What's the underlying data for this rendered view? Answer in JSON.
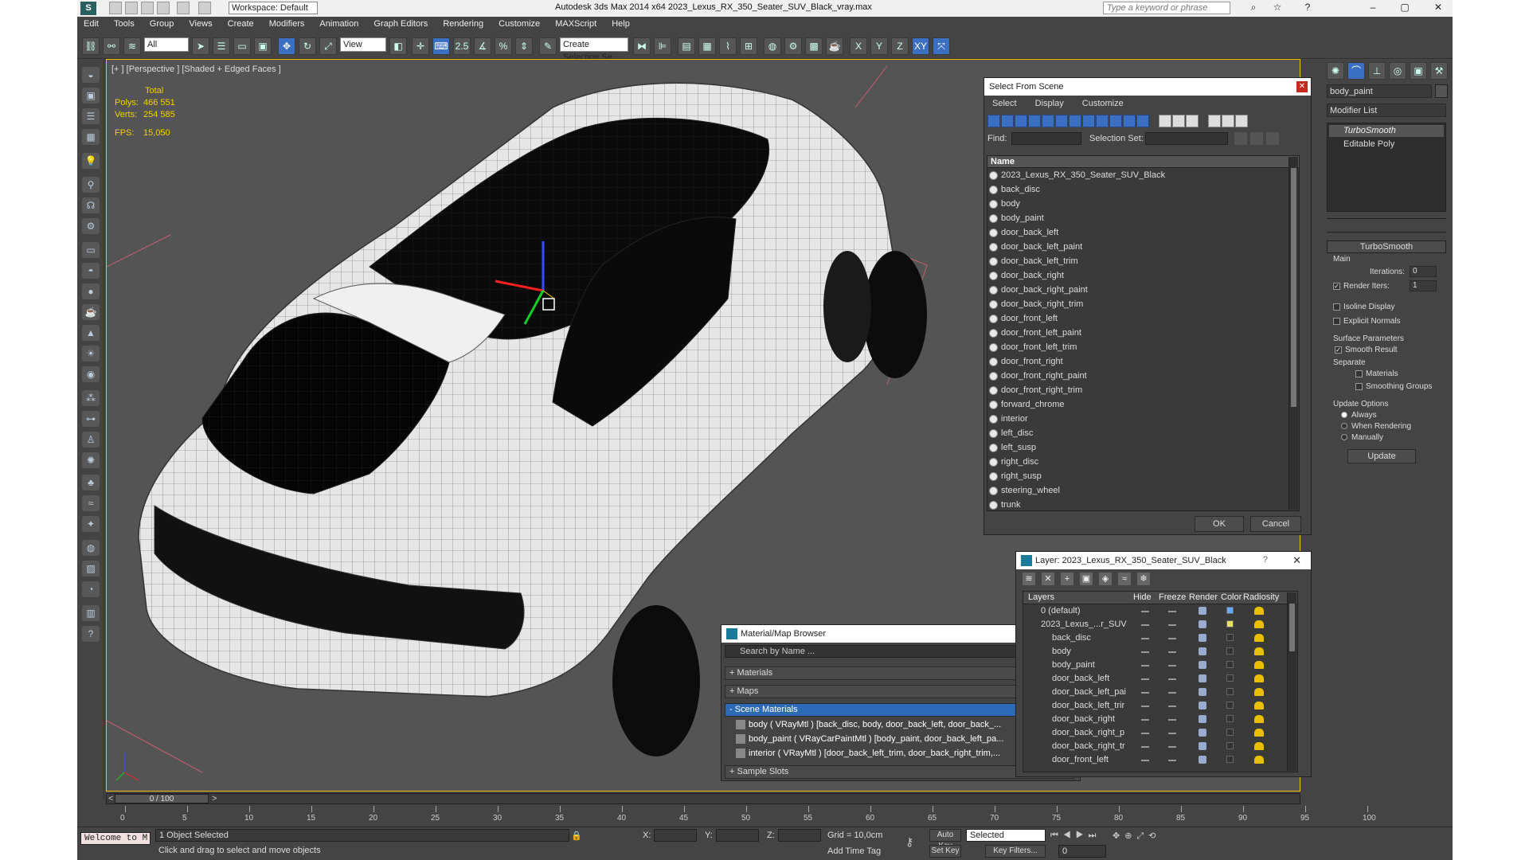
{
  "app": {
    "workspace": "Workspace: Default",
    "title": "Autodesk 3ds Max  2014 x64    2023_Lexus_RX_350_Seater_SUV_Black_vray.max",
    "search_placeholder": "Type a keyword or phrase"
  },
  "menu": [
    "Edit",
    "Tools",
    "Group",
    "Views",
    "Create",
    "Modifiers",
    "Animation",
    "Graph Editors",
    "Rendering",
    "Customize",
    "MAXScript",
    "Help"
  ],
  "toolbar": {
    "filter": "All",
    "refcoord": "View",
    "selset": "Create Selection Se",
    "x": "X",
    "y": "Y",
    "z": "Z",
    "xy": "XY",
    "num25": "2.5",
    "pct": "%"
  },
  "viewport": {
    "label": "[+ ] [Perspective ] [Shaded + Edged Faces ]",
    "stats": {
      "total": "Total",
      "polys_label": "Polys:",
      "polys": "466 551",
      "verts_label": "Verts:",
      "verts": "254 585",
      "fps_label": "FPS:",
      "fps": "15,050"
    }
  },
  "select_from_scene": {
    "title": "Select From Scene",
    "menu": [
      "Select",
      "Display",
      "Customize"
    ],
    "find_label": "Find:",
    "selset_label": "Selection Set:",
    "col_name": "Name",
    "items": [
      "2023_Lexus_RX_350_Seater_SUV_Black",
      "back_disc",
      "body",
      "body_paint",
      "door_back_left",
      "door_back_left_paint",
      "door_back_left_trim",
      "door_back_right",
      "door_back_right_paint",
      "door_back_right_trim",
      "door_front_left",
      "door_front_left_paint",
      "door_front_left_trim",
      "door_front_right",
      "door_front_right_paint",
      "door_front_right_trim",
      "forward_chrome",
      "interior",
      "left_disc",
      "left_susp",
      "right_disc",
      "right_susp",
      "steering_wheel",
      "trunk"
    ],
    "ok": "OK",
    "cancel": "Cancel"
  },
  "material_browser": {
    "title": "Material/Map Browser",
    "search": "Search by Name ...",
    "rollouts": {
      "materials": "+ Materials",
      "maps": "+ Maps",
      "scene": "- Scene Materials",
      "samples": "+ Sample Slots"
    },
    "scene_materials": [
      "body ( VRayMtl ) [back_disc, body, door_back_left, door_back_...",
      "body_paint ( VRayCarPaintMtl ) [body_paint, door_back_left_pa...",
      "interior ( VRayMtl ) [door_back_left_trim, door_back_right_trim,..."
    ]
  },
  "layer_dialog": {
    "title": "Layer: 2023_Lexus_RX_350_Seater_SUV_Black",
    "help": "?",
    "cols": {
      "layers": "Layers",
      "hide": "Hide",
      "freeze": "Freeze",
      "render": "Render",
      "color": "Color",
      "radiosity": "Radiosity"
    },
    "rows": [
      "0 (default)",
      "2023_Lexus_...r_SUV",
      "back_disc",
      "body",
      "body_paint",
      "door_back_left",
      "door_back_left_pai",
      "door_back_left_trir",
      "door_back_right",
      "door_back_right_p",
      "door_back_right_tr",
      "door_front_left"
    ]
  },
  "command_panel": {
    "object_name": "body_paint",
    "modifier_list": "Modifier List",
    "stack": [
      "TurboSmooth",
      "Editable Poly"
    ],
    "rollout_title": "TurboSmooth",
    "main": "Main",
    "iterations_label": "Iterations:",
    "iterations": "0",
    "render_iters_label": "Render Iters:",
    "render_iters": "1",
    "isoline": "Isoline Display",
    "explicit": "Explicit Normals",
    "surface": "Surface Parameters",
    "smooth_result": "Smooth Result",
    "separate": "Separate",
    "materials": "Materials",
    "smoothing_groups": "Smoothing Groups",
    "update_options": "Update Options",
    "always": "Always",
    "when_rendering": "When Rendering",
    "manually": "Manually",
    "update": "Update"
  },
  "timeline": {
    "frame": "0 / 100",
    "ticks": [
      "0",
      "5",
      "10",
      "15",
      "20",
      "25",
      "30",
      "35",
      "40",
      "45",
      "50",
      "55",
      "60",
      "65",
      "70",
      "75",
      "80",
      "85",
      "90",
      "95",
      "100"
    ]
  },
  "status": {
    "welcome": "Welcome to M",
    "selected": "1 Object Selected",
    "prompt": "Click and drag to select and move objects",
    "x_label": "X:",
    "y_label": "Y:",
    "z_label": "Z:",
    "grid": "Grid = 10,0cm",
    "add_time_tag": "Add Time Tag",
    "auto_key": "Auto Key",
    "set_key": "Set Key",
    "sel_mode": "Selected",
    "key_filters": "Key Filters...",
    "frame_value": "0"
  }
}
